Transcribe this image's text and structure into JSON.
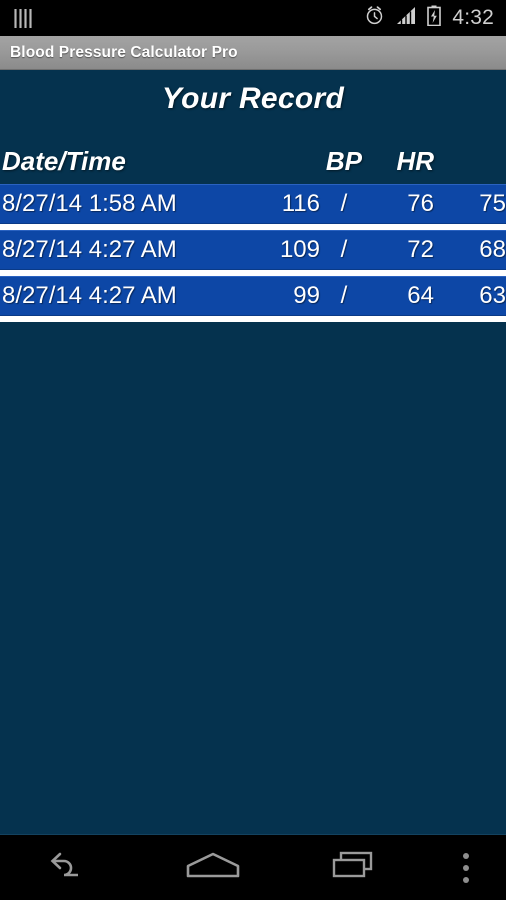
{
  "status_bar": {
    "left_icon": "vertical-bars-icon",
    "alarm_icon": "alarm-clock-icon",
    "signal_icon": "signal-bars-icon",
    "battery_icon": "battery-charging-icon",
    "time": "4:32"
  },
  "title_bar": {
    "app_title": "Blood Pressure Calculator Pro"
  },
  "main": {
    "page_title": "Your Record",
    "table": {
      "headers": {
        "datetime": "Date/Time",
        "bp": "BP",
        "hr": "HR"
      },
      "separator": "/",
      "rows": [
        {
          "datetime": "8/27/14 1:58 AM",
          "systolic": "116",
          "slash": "/",
          "diastolic": "76",
          "hr": "75"
        },
        {
          "datetime": "8/27/14 4:27 AM",
          "systolic": "109",
          "slash": "/",
          "diastolic": "72",
          "hr": "68"
        },
        {
          "datetime": "8/27/14 4:27 AM",
          "systolic": "99",
          "slash": "/",
          "diastolic": "64",
          "hr": "63"
        }
      ]
    }
  },
  "nav_bar": {
    "back": "back-icon",
    "home": "home-icon",
    "recents": "recent-apps-icon",
    "overflow": "overflow-menu-icon"
  },
  "colors": {
    "app_background": "#05324e",
    "row_highlight": "#0d47a6",
    "row_separator": "#ffffff",
    "title_bar_gray": "#9a9a9a",
    "status_bar_black": "#000000",
    "text_white": "#ffffff"
  }
}
